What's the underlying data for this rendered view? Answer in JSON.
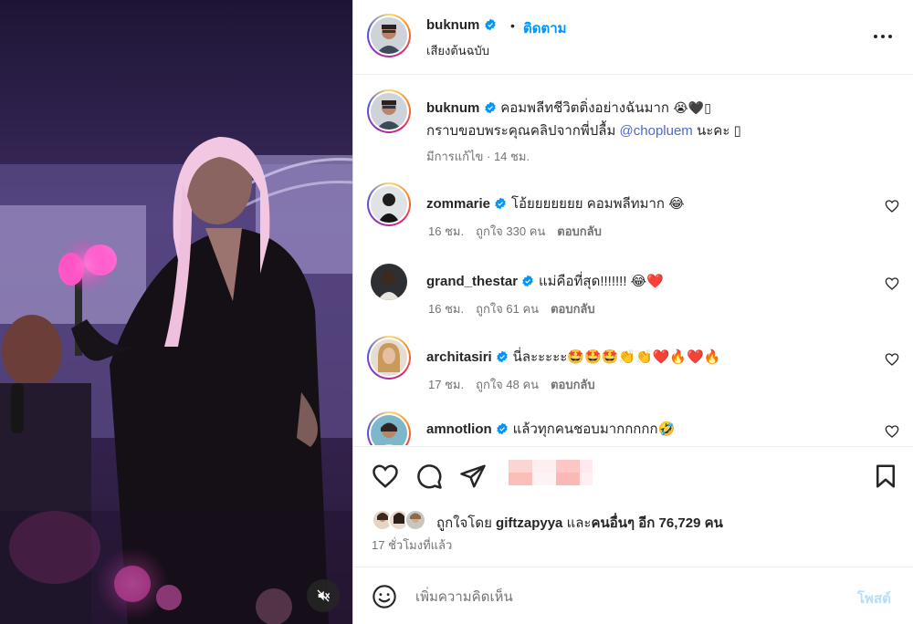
{
  "post_author": {
    "username": "buknum",
    "follow_label": "ติดตาม",
    "audio_label": "เสียงต้นฉบับ",
    "separator": "•"
  },
  "caption": {
    "username": "buknum",
    "line1": "คอมพลีทชีวิตติ่งอย่างฉันมาก",
    "line1_emoji": "😭🖤▯",
    "line2_prefix": "กราบขอบพระคุณคลิปจากพี่ปลื้ม ",
    "mention": "@chopluem",
    "line2_suffix": " นะคะ ▯",
    "meta": "มีการแก้ไข · 14 ชม."
  },
  "comments": [
    {
      "username": "zommarie",
      "text": "โอ้ยยยยยยย คอมพลีทมาก 😂",
      "time": "16 ชม.",
      "likes": "ถูกใจ 330 คน",
      "reply": "ตอบกลับ"
    },
    {
      "username": "grand_thestar",
      "text": "แม่คือที่สุด!!!!!!! 😂❤️",
      "time": "16 ชม.",
      "likes": "ถูกใจ 61 คน",
      "reply": "ตอบกลับ"
    },
    {
      "username": "architasiri",
      "text": "นี่ละะะะะ🤩🤩🤩👏👏❤️🔥❤️🔥",
      "time": "17 ชม.",
      "likes": "ถูกใจ 48 คน",
      "reply": "ตอบกลับ"
    },
    {
      "username": "amnotlion",
      "text": "แล้วทุกคนชอบมากกกกก🤣",
      "time": "",
      "likes": "",
      "reply": ""
    }
  ],
  "likes": {
    "prefix": "ถูกใจโดย ",
    "first_liker": "giftzapyya",
    "middle": " และ",
    "others": "คนอื่นๆ อีก 76,729 คน"
  },
  "time_ago": "17 ชั่วโมงที่แล้ว",
  "comment_box": {
    "placeholder": "เพิ่มความคิดเห็น",
    "post_label": "โพสต์"
  },
  "colors": {
    "link": "#0095f6",
    "mention": "#4e67d3",
    "muted": "#737373",
    "post_disabled": "#b2dffc",
    "verified": "#0095f6"
  },
  "icons": [
    "verified-icon",
    "more-icon",
    "heart-icon",
    "comment-icon",
    "share-icon",
    "bookmark-icon",
    "smile-icon",
    "mute-icon"
  ]
}
